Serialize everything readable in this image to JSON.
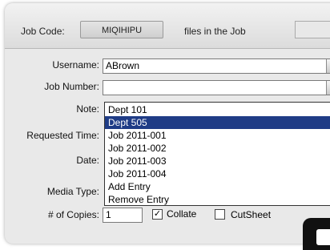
{
  "header": {
    "job_code_label": "Job Code:",
    "job_code_value": "MIQIHIPU",
    "files_label": "files in the Job"
  },
  "form": {
    "username_label": "Username:",
    "username_value": "ABrown",
    "job_number_label": "Job Number:",
    "job_number_value": "",
    "note_label": "Note:",
    "requested_time_label": "Requested Time:",
    "date_label": "Date:",
    "media_type_label": "Media Type:",
    "copies_label": "# of Copies:",
    "copies_value": "1",
    "collate_label": "Collate",
    "collate_checked": "✓",
    "cutsheet_label": "CutSheet"
  },
  "dropdown": {
    "options": [
      "Dept 101",
      "Dept 505",
      "Job 2011-001",
      "Job 2011-002",
      "Job 2011-003",
      "Job 2011-004",
      "Add Entry",
      "Remove Entry"
    ],
    "selected_index": 1
  },
  "icons": {
    "dropdown_arrow": "chevron-down-icon",
    "check": "checkmark-icon"
  },
  "colors": {
    "selection": "#1f3c86",
    "panel": "#e9e9e9"
  }
}
